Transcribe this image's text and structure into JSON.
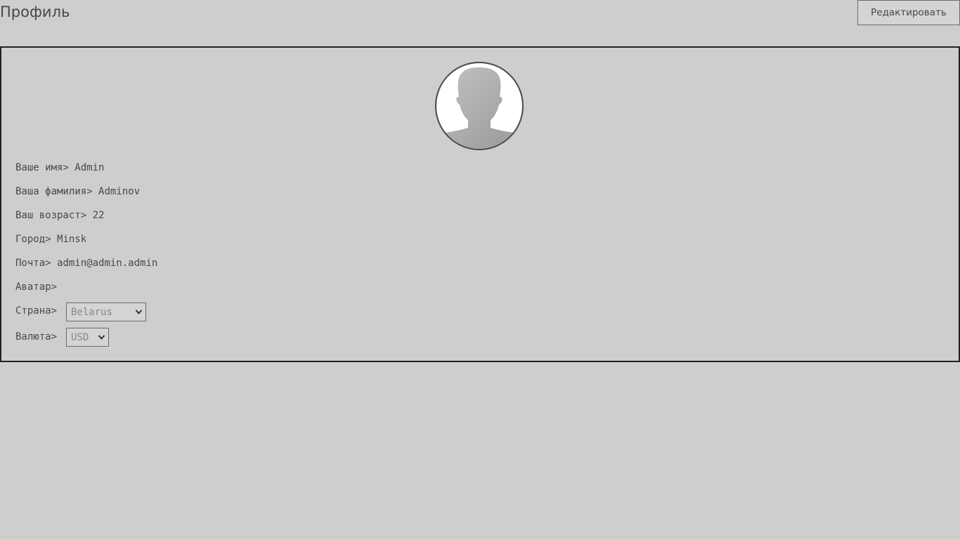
{
  "header": {
    "title": "Профиль",
    "edit_label": "Редактировать"
  },
  "profile": {
    "name_label": "Ваше имя>",
    "name_value": "Admin",
    "surname_label": "Ваша фамилия>",
    "surname_value": "Adminov",
    "age_label": "Ваш возраст>",
    "age_value": "22",
    "city_label": "Город>",
    "city_value": "Minsk",
    "email_label": "Почта>",
    "email_value": "admin@admin.admin",
    "avatar_label": "Аватар>",
    "country_label": "Страна>",
    "country_value": "Belarus",
    "currency_label": "Валюта>",
    "currency_value": "USD"
  },
  "icons": {
    "avatar": "user-silhouette-icon",
    "dropdown": "chevron-down-icon"
  },
  "colors": {
    "background": "#cecece",
    "text": "#4a4747",
    "border": "#222222"
  }
}
